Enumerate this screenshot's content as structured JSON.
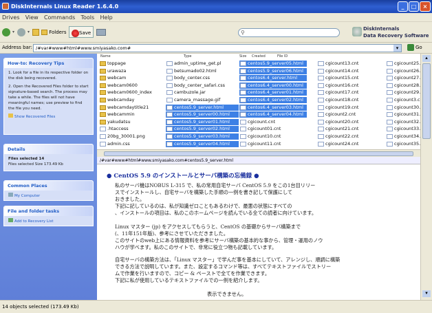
{
  "window": {
    "title": "DiskInternals Linux Reader 1.6.4.0"
  },
  "menu": [
    "Drives",
    "View",
    "Commands",
    "Tools",
    "Help"
  ],
  "toolbar": {
    "folders_label": "Folders",
    "save_label": "Save",
    "search_value": "",
    "brand_line1": "DiskInternals",
    "brand_line2": "Data Recovery Software"
  },
  "address": {
    "label": "Address bar:",
    "value": "/#var#www#html#www.smiyasako.com#",
    "go_label": "Go"
  },
  "columns": {
    "name": "Name",
    "type": "Type",
    "size": "Size",
    "created": "Created",
    "fileid": "File ID"
  },
  "left": {
    "tips": {
      "title": "How-to: Recovery Tips",
      "text1": "1. Look for a file in its respective folder on the disk being recovered.",
      "text2": "2. Open the Recovered Files folder to start signature-based search. The process may take a while. The files will not have meaningful names; use preview to find the file you need.",
      "link": "Show Recovered Files"
    },
    "details": {
      "title": "Details",
      "line1": "Files selected 14",
      "line2": "Files selected Size 173.49 Kb"
    },
    "places": {
      "title": "Common Places",
      "item": "My Computer"
    },
    "tasks": {
      "title": "File and folder tasks",
      "item": "Add to Recovery List"
    }
  },
  "files": {
    "col1": [
      {
        "name": "toppage",
        "kind": "folder",
        "selected": false
      },
      {
        "name": "urawaza",
        "kind": "folder",
        "selected": false
      },
      {
        "name": "webcam",
        "kind": "folder",
        "selected": false
      },
      {
        "name": "webcam0600",
        "kind": "folder",
        "selected": false
      },
      {
        "name": "webcam0600_index",
        "kind": "folder",
        "selected": false
      },
      {
        "name": "webcamday",
        "kind": "folder",
        "selected": false
      },
      {
        "name": "webcamdaytitle21",
        "kind": "folder",
        "selected": false
      },
      {
        "name": "webcammin",
        "kind": "folder",
        "selected": false
      },
      {
        "name": "yakudatsu",
        "kind": "folder",
        "selected": false
      },
      {
        "name": ".htaccess",
        "kind": "file",
        "selected": false
      },
      {
        "name": "20bg_30001.png",
        "kind": "file",
        "selected": false
      },
      {
        "name": "admin.css",
        "kind": "file",
        "selected": false
      }
    ],
    "col2": [
      {
        "name": "admin_uptime_get.pl",
        "selected": false
      },
      {
        "name": "betsumado02.html",
        "selected": false
      },
      {
        "name": "body_center.css",
        "selected": false
      },
      {
        "name": "body_center_safari.css",
        "selected": false
      },
      {
        "name": "cambuzole.jar",
        "selected": false
      },
      {
        "name": "camera_massage.gif",
        "selected": false
      },
      {
        "name": "centos5.9_server.html",
        "selected": true
      },
      {
        "name": "centos5.9_server00.html",
        "selected": true
      },
      {
        "name": "centos5.9_server01.html",
        "selected": true
      },
      {
        "name": "centos5.9_server02.html",
        "selected": true
      },
      {
        "name": "centos5.9_server03.html",
        "selected": true
      },
      {
        "name": "centos5.9_server04.html",
        "selected": true
      }
    ],
    "col3": [
      {
        "name": "centos5.9_server05.html",
        "selected": true
      },
      {
        "name": "centos5.9_server06.html",
        "selected": true
      },
      {
        "name": "centos6.4_server.html",
        "selected": true
      },
      {
        "name": "centos6.4_server00.html",
        "selected": true
      },
      {
        "name": "centos6.4_server01.html",
        "selected": true
      },
      {
        "name": "centos6.4_server02.html",
        "selected": true
      },
      {
        "name": "centos6.4_server03.html",
        "selected": true
      },
      {
        "name": "centos6.4_server04.html",
        "selected": true
      },
      {
        "name": "cgicount.cnt",
        "selected": false
      },
      {
        "name": "cgicount01.cnt",
        "selected": false
      },
      {
        "name": "cgicount10.cnt",
        "selected": false
      },
      {
        "name": "cgicount11.cnt",
        "selected": false
      }
    ],
    "col4": [
      {
        "name": "cgicount13.cnt"
      },
      {
        "name": "cgicount14.cnt"
      },
      {
        "name": "cgicount15.cnt"
      },
      {
        "name": "cgicount16.cnt"
      },
      {
        "name": "cgicount17.cnt"
      },
      {
        "name": "cgicount18.cnt"
      },
      {
        "name": "cgicount19.cnt"
      },
      {
        "name": "cgicount2.cnt"
      },
      {
        "name": "cgicount20.cnt"
      },
      {
        "name": "cgicount21.cnt"
      },
      {
        "name": "cgicount22.cnt"
      },
      {
        "name": "cgicount24.cnt"
      }
    ],
    "col5": [
      {
        "name": "cgicount25.cnt"
      },
      {
        "name": "cgicount26.cnt"
      },
      {
        "name": "cgicount27.cnt"
      },
      {
        "name": "cgicount28.cnt"
      },
      {
        "name": "cgicount29.cnt"
      },
      {
        "name": "cgicount3.cnt"
      },
      {
        "name": "cgicount30.cnt"
      },
      {
        "name": "cgicount31.cnt"
      },
      {
        "name": "cgicount32.cnt"
      },
      {
        "name": "cgicount33.cnt"
      },
      {
        "name": "cgicount34.cnt"
      },
      {
        "name": "cgicount35.cnt"
      }
    ]
  },
  "preview": {
    "path": "/#var#www#html#www.smiyasako.com#centos5.9_server.html",
    "heading": "● CentOS 5.9 のインストールとサーバ構築の忘備録 ●",
    "lines": [
      "私のサーバ機はNOBUS L-315 で、私の常用自宅サーバ CentOS 5.9 をこの1台目リリー",
      "スでインストールし、自宅サーバを構築した手順の一例を書き記して保護にして",
      "おきました。",
      "下記に記しているのは、私が知識ゼロこともあるわけで、最悪の状態にすべての",
      "、インストールの項目は、私のこのホームページを読んでいる全ての読者に向けています。",
      "Linux マスター (jp) をアクセスしてもらうと、CentOS の基礎からサーバ構築まで",
      "(、11年151年版)、参考にさせていただきました。",
      "このサイトのweb上にある情報資料を参考にサーバ構築の基本的な事から、管理・運用のノウ",
      "ハウが学べます。私のこのサイトで、非常に役立つ物も記載しています。",
      "自宅サーバの構築方法は、「Linux マスター」で学んだ事を基本にしていて、アレンジし、順調に構築",
      "できる方法で説明しています。また、設定するコマンド等は、すべてテキストファイルでストリー",
      "ムで作業を行いますので、コピー & ペーストで全てを作業できます。",
      "下記に私が使用しているテキストファイルでの一例を紹介します。",
      "表示できません。"
    ]
  },
  "status": {
    "text": "14 objects selected (173.49 Kb)"
  }
}
